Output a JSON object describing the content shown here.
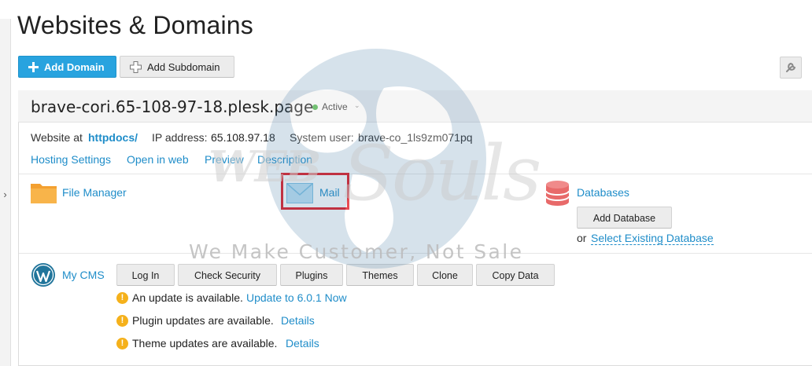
{
  "page": {
    "title": "Websites & Domains"
  },
  "toolbar": {
    "add_domain": "Add Domain",
    "add_subdomain": "Add Subdomain"
  },
  "domain": {
    "name": "brave-cori.65-108-97-18.plesk.page",
    "status": "Active",
    "website_at_label": "Website at",
    "website_path": "httpdocs/",
    "ip_label": "IP address:",
    "ip_value": "65.108.97.18",
    "system_user_label": "System user:",
    "system_user_value": "brave-co_1ls9zm071pq",
    "links": {
      "hosting_settings": "Hosting Settings",
      "open_in_web": "Open in web",
      "preview": "Preview",
      "description": "Description"
    }
  },
  "tools": {
    "file_manager": "File Manager",
    "mail": "Mail",
    "databases": "Databases",
    "add_database": "Add Database",
    "or_label": "or",
    "select_existing_database": "Select Existing Database"
  },
  "cms": {
    "label": "My CMS",
    "buttons": [
      "Log In",
      "Check Security",
      "Plugins",
      "Themes",
      "Clone",
      "Copy Data"
    ],
    "notices": [
      {
        "text": "An update is available.",
        "link": "Update to 6.0.1 Now"
      },
      {
        "text": "Plugin updates are available.",
        "link": "Details"
      },
      {
        "text": "Theme updates are available.",
        "link": "Details"
      }
    ]
  },
  "watermark": {
    "brand_left": "WEB",
    "brand_right": "Souls",
    "tagline": "We Make Customer, Not Sale"
  },
  "colors": {
    "primary": "#28a3df",
    "link": "#1f8dc9",
    "active": "#4cae4c",
    "warning": "#f5b11b",
    "highlight": "#e21b24"
  },
  "icons": [
    "chevron-right-icon",
    "plus-icon",
    "plus-outline-icon",
    "wrench-icon",
    "folder-icon",
    "envelope-icon",
    "database-icon",
    "wordpress-icon",
    "warning-icon",
    "globe-icon"
  ]
}
